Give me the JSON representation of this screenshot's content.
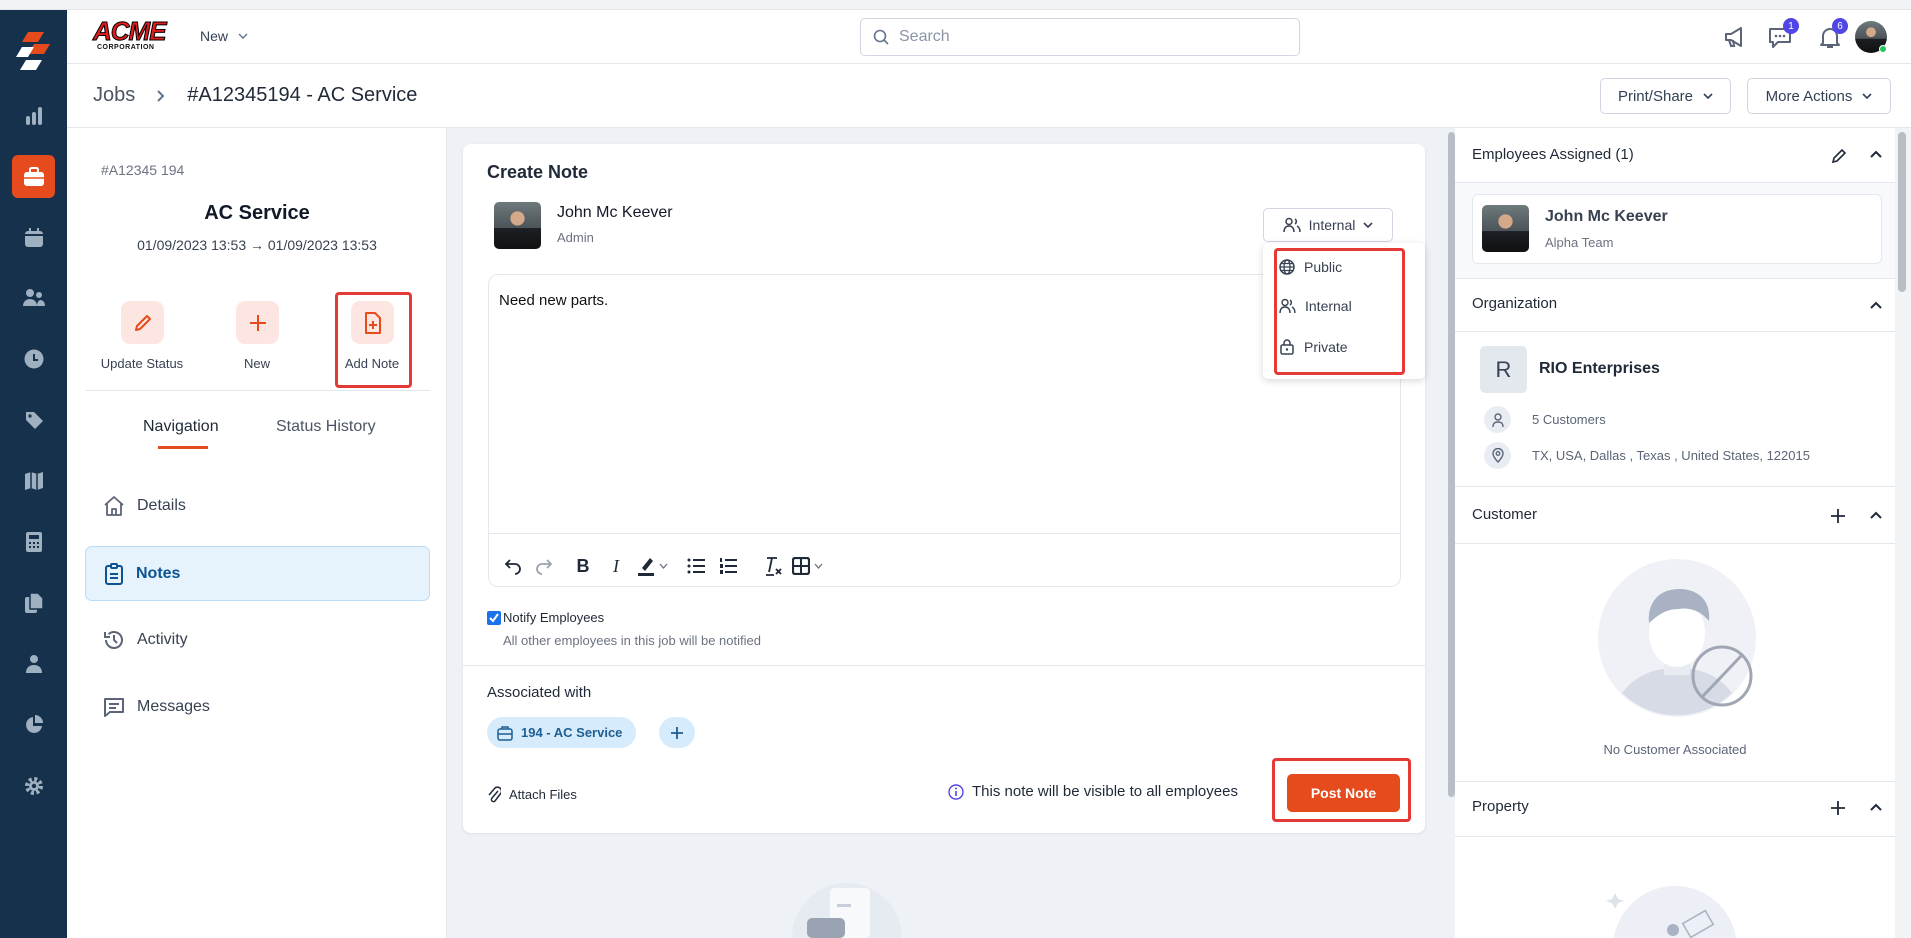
{
  "header": {
    "logo_text": "ACME",
    "logo_sub": "CORPORATION",
    "new_label": "New",
    "search_placeholder": "Search",
    "chat_badge": "1",
    "notif_badge": "6"
  },
  "breadcrumb": {
    "root": "Jobs",
    "current": "#A12345194 - AC Service"
  },
  "actions": {
    "print_share": "Print/Share",
    "more_actions": "More Actions"
  },
  "job": {
    "id": "#A12345 194",
    "title": "AC Service",
    "dates": "01/09/2023 13:53 → 01/09/2023 13:53"
  },
  "quick_actions": [
    {
      "label": "Update Status"
    },
    {
      "label": "New"
    },
    {
      "label": "Add Note"
    }
  ],
  "tabs": {
    "navigation": "Navigation",
    "status_history": "Status History"
  },
  "nav": [
    {
      "label": "Details"
    },
    {
      "label": "Notes"
    },
    {
      "label": "Activity"
    },
    {
      "label": "Messages"
    }
  ],
  "note": {
    "title": "Create Note",
    "author": "John Mc Keever",
    "role": "Admin",
    "visibility": "Internal",
    "visibility_options": [
      {
        "label": "Public"
      },
      {
        "label": "Internal"
      },
      {
        "label": "Private"
      }
    ],
    "body": "Need new parts.",
    "notify_label": "Notify Employees",
    "notify_checked": true,
    "notify_help": "All other employees in this job will be notified",
    "associated_label": "Associated with",
    "associated_chip": "194 - AC Service",
    "attach_label": "Attach Files",
    "visibility_info": "This note will be visible to all employees",
    "post_label": "Post Note"
  },
  "right": {
    "employees_title": "Employees Assigned (1)",
    "employee_name": "John Mc Keever",
    "employee_team": "Alpha Team",
    "org_title": "Organization",
    "org_initial": "R",
    "org_name": "RIO Enterprises",
    "org_customers": "5 Customers",
    "org_address": "TX, USA, Dallas , Texas , United States, 122015",
    "customer_title": "Customer",
    "no_customer": "No Customer Associated",
    "property_title": "Property"
  },
  "colors": {
    "brand": "#e54b1c",
    "sidebar": "#15314c",
    "highlight": "#e53935",
    "badge": "#4f46e5"
  }
}
